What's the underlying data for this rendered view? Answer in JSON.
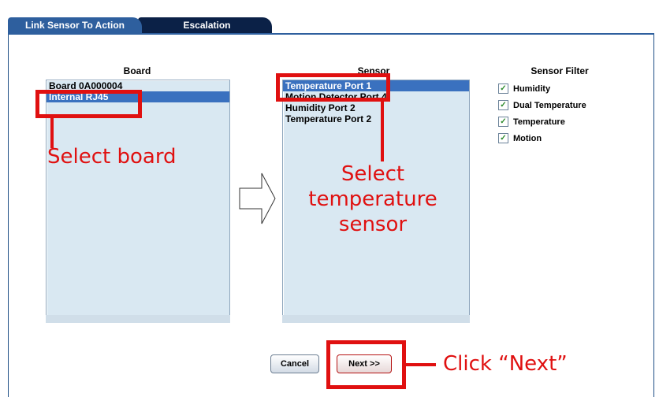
{
  "tabs": [
    {
      "label": "Link Sensor To Action",
      "active": true
    },
    {
      "label": "Escalation",
      "active": false
    }
  ],
  "board": {
    "heading": "Board",
    "items": [
      {
        "label": "Board 0A000004",
        "selected": false
      },
      {
        "label": "Internal RJ45",
        "selected": true
      }
    ]
  },
  "sensor": {
    "heading": "Sensor",
    "items": [
      {
        "label": "Temperature Port 1",
        "selected": true
      },
      {
        "label": "Motion Detector Port 4",
        "selected": false
      },
      {
        "label": "Humidity Port 2",
        "selected": false
      },
      {
        "label": "Temperature Port 2",
        "selected": false
      }
    ]
  },
  "sensor_filter": {
    "heading": "Sensor Filter",
    "options": [
      {
        "label": "Humidity",
        "checked": true
      },
      {
        "label": "Dual Temperature",
        "checked": true
      },
      {
        "label": "Temperature",
        "checked": true
      },
      {
        "label": "Motion",
        "checked": true
      }
    ]
  },
  "buttons": {
    "cancel": "Cancel",
    "next": "Next >>"
  },
  "annotations": {
    "select_board": "Select board",
    "select_sensor": "Select temperature sensor",
    "click_next": "Click “Next”"
  },
  "icons": {
    "arrow": "right-arrow-icon",
    "check": "check-icon"
  },
  "colors": {
    "tab_active": "#2e5f9e",
    "tab_inactive": "#0b2147",
    "selection": "#3a71bf",
    "annotation": "#e01010",
    "list_bg": "#d9e8f2"
  }
}
